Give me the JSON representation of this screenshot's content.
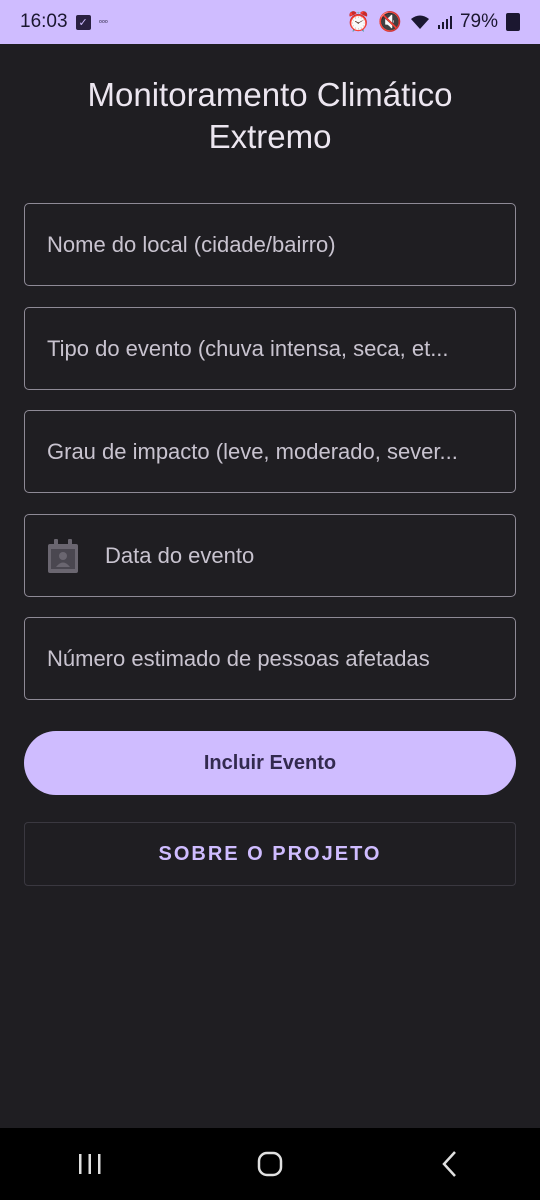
{
  "status_bar": {
    "time": "16:03",
    "battery": "79%",
    "notification_icons": [
      "check-icon",
      "sos-icon"
    ],
    "system_icons": [
      "alarm-icon",
      "mute-icon",
      "wifi-icon",
      "signal-icon",
      "battery-charging-icon"
    ]
  },
  "title": {
    "line1": "Monitoramento Climático",
    "line2": "Extremo"
  },
  "fields": {
    "location_placeholder": "Nome do local (cidade/bairro)",
    "event_type_placeholder": "Tipo do evento (chuva intensa, seca, et...",
    "impact_placeholder": "Grau de impacto (leve, moderado, sever...",
    "date_placeholder": "Data do evento",
    "people_placeholder": "Número estimado de pessoas afetadas"
  },
  "buttons": {
    "add_event": "Incluir Evento",
    "about": "SOBRE O PROJETO"
  },
  "colors": {
    "accent": "#cfbcff",
    "background": "#1f1e22",
    "outline": "#8e8a96"
  }
}
